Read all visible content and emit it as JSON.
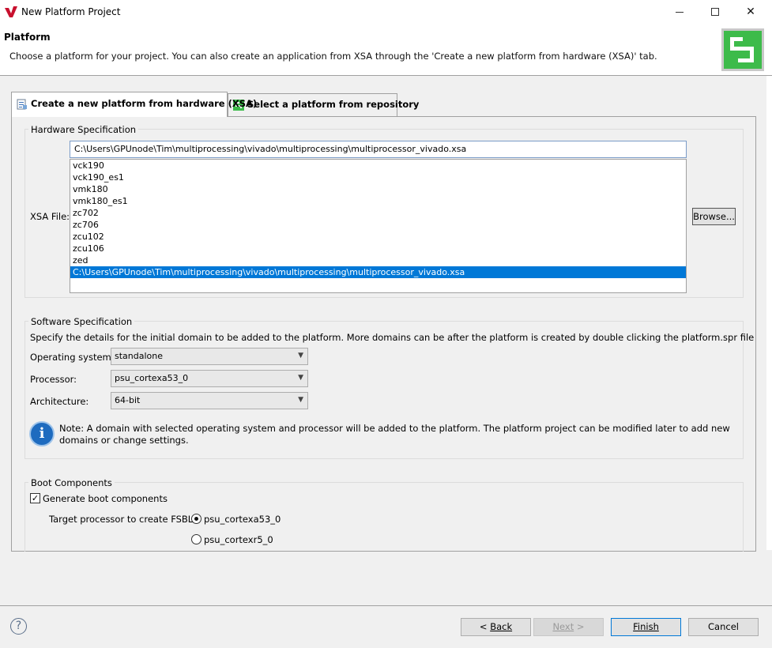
{
  "window": {
    "title": "New Platform Project"
  },
  "banner": {
    "title": "Platform",
    "description": "Choose a platform for your project. You can also create an application from XSA through the 'Create a new platform from hardware (XSA)' tab."
  },
  "tabs": [
    {
      "label": "Create a new platform from hardware (XSA)"
    },
    {
      "label": "Select a platform from repository"
    }
  ],
  "hardware": {
    "group_label": "Hardware Specification",
    "xsa_label": "XSA File:",
    "xsa_value": "C:\\Users\\GPUnode\\Tim\\multiprocessing\\vivado\\multiprocessing\\multiprocessor_vivado.xsa",
    "xsa_options": [
      "vck190",
      "vck190_es1",
      "vmk180",
      "vmk180_es1",
      "zc702",
      "zc706",
      "zcu102",
      "zcu106",
      "zed",
      "C:\\Users\\GPUnode\\Tim\\multiprocessing\\vivado\\multiprocessing\\multiprocessor_vivado.xsa"
    ],
    "browse_label": "Browse..."
  },
  "software": {
    "group_label": "Software Specification",
    "description": "Specify the details for the initial domain to be added to the platform. More domains can be after the platform is created by double clicking the platform.spr file",
    "os_label": "Operating system:",
    "os_value": "standalone",
    "processor_label": "Processor:",
    "processor_value": "psu_cortexa53_0",
    "arch_label": "Architecture:",
    "arch_value": "64-bit",
    "note": "Note: A domain with selected operating system and processor will be added to the platform. The platform project can be modified later to add new domains or change settings."
  },
  "boot": {
    "group_label": "Boot Components",
    "generate_label": "Generate boot components",
    "generate_checked": true,
    "fsbl_label": "Target processor to create FSBL:",
    "fsbl_options": [
      "psu_cortexa53_0",
      "psu_cortexr5_0"
    ],
    "fsbl_selected": "psu_cortexa53_0"
  },
  "footer": {
    "help_glyph": "?",
    "back_label": "Back",
    "next_label": "Next",
    "finish_label": "Finish",
    "cancel_label": "Cancel"
  },
  "colors": {
    "accent": "#0078d7",
    "logo": "#3dbb4a",
    "brand_red": "#c8102e"
  }
}
